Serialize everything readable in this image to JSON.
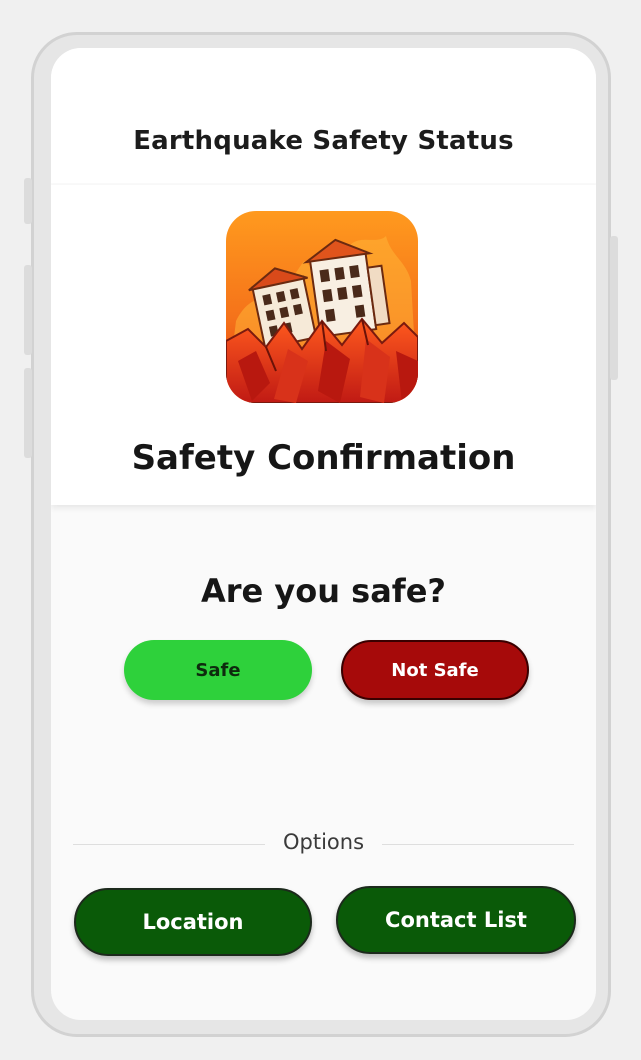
{
  "header": {
    "title": "Earthquake Safety Status"
  },
  "card": {
    "icon": "earthquake-buildings-icon",
    "title": "Safety Confirmation"
  },
  "prompt": {
    "question": "Are you safe?",
    "safe_label": "Safe",
    "not_safe_label": "Not Safe"
  },
  "options": {
    "label": "Options",
    "location_label": "Location",
    "contacts_label": "Contact List"
  },
  "colors": {
    "safe": "#2ed13b",
    "not_safe": "#a60a0a",
    "option_buttons": "#0a5a08",
    "icon_gradient_top": "#ff9a1e",
    "icon_gradient_bottom": "#e43a12"
  }
}
